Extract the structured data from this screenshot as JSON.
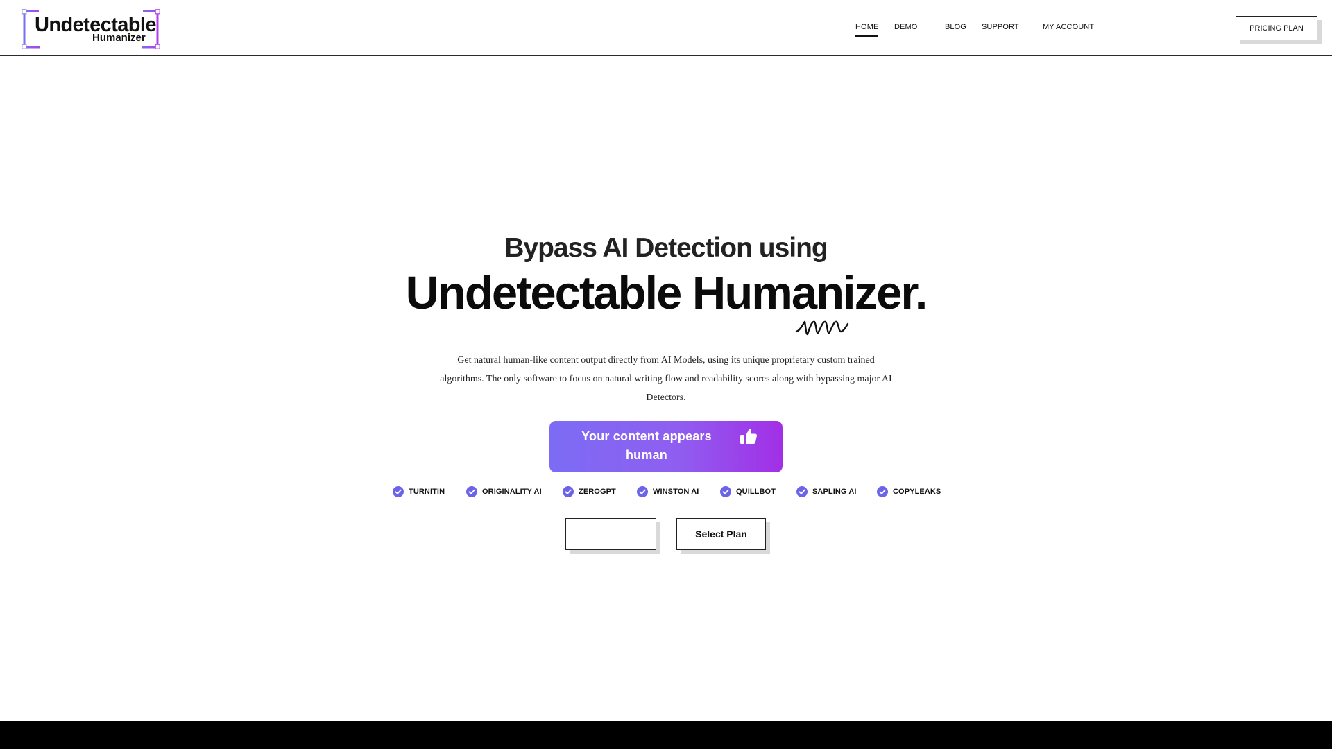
{
  "logo": {
    "main": "Undetectable",
    "sub": "Humanizer",
    "accent_start": "#7b6ff0",
    "accent_end": "#b040e8"
  },
  "nav": {
    "items": [
      {
        "label": "HOME",
        "active": true
      },
      {
        "label": "DEMO",
        "active": false
      },
      {
        "label": "BLOG",
        "active": false
      },
      {
        "label": "SUPPORT",
        "active": false
      },
      {
        "label": "MY ACCOUNT",
        "active": false
      }
    ],
    "pricing_label": "PRICING PLAN"
  },
  "hero": {
    "subtitle": "Bypass AI Detection using",
    "title": "Undetectable Humanizer.",
    "description": "Get natural human-like content output directly from AI Models, using its unique proprietary custom trained algorithms. The only software to focus on natural writing flow and readability scores along with bypassing major AI Detectors.",
    "status_label": "Your content appears human",
    "status_icon": "thumbs-up-icon",
    "gradient_start": "#7c6cf5",
    "gradient_end": "#a22fe6"
  },
  "detectors": {
    "icon": "check-circle-icon",
    "check_color": "#6b63e8",
    "items": [
      "TURNITIN",
      "ORIGINALITY AI",
      "ZEROGPT",
      "WINSTON AI",
      "QUILLBOT",
      "SAPLING AI",
      "COPYLEAKS"
    ]
  },
  "cta": {
    "primary_label": "",
    "secondary_label": "Select Plan"
  },
  "footer": {
    "bar_color": "#000000"
  }
}
